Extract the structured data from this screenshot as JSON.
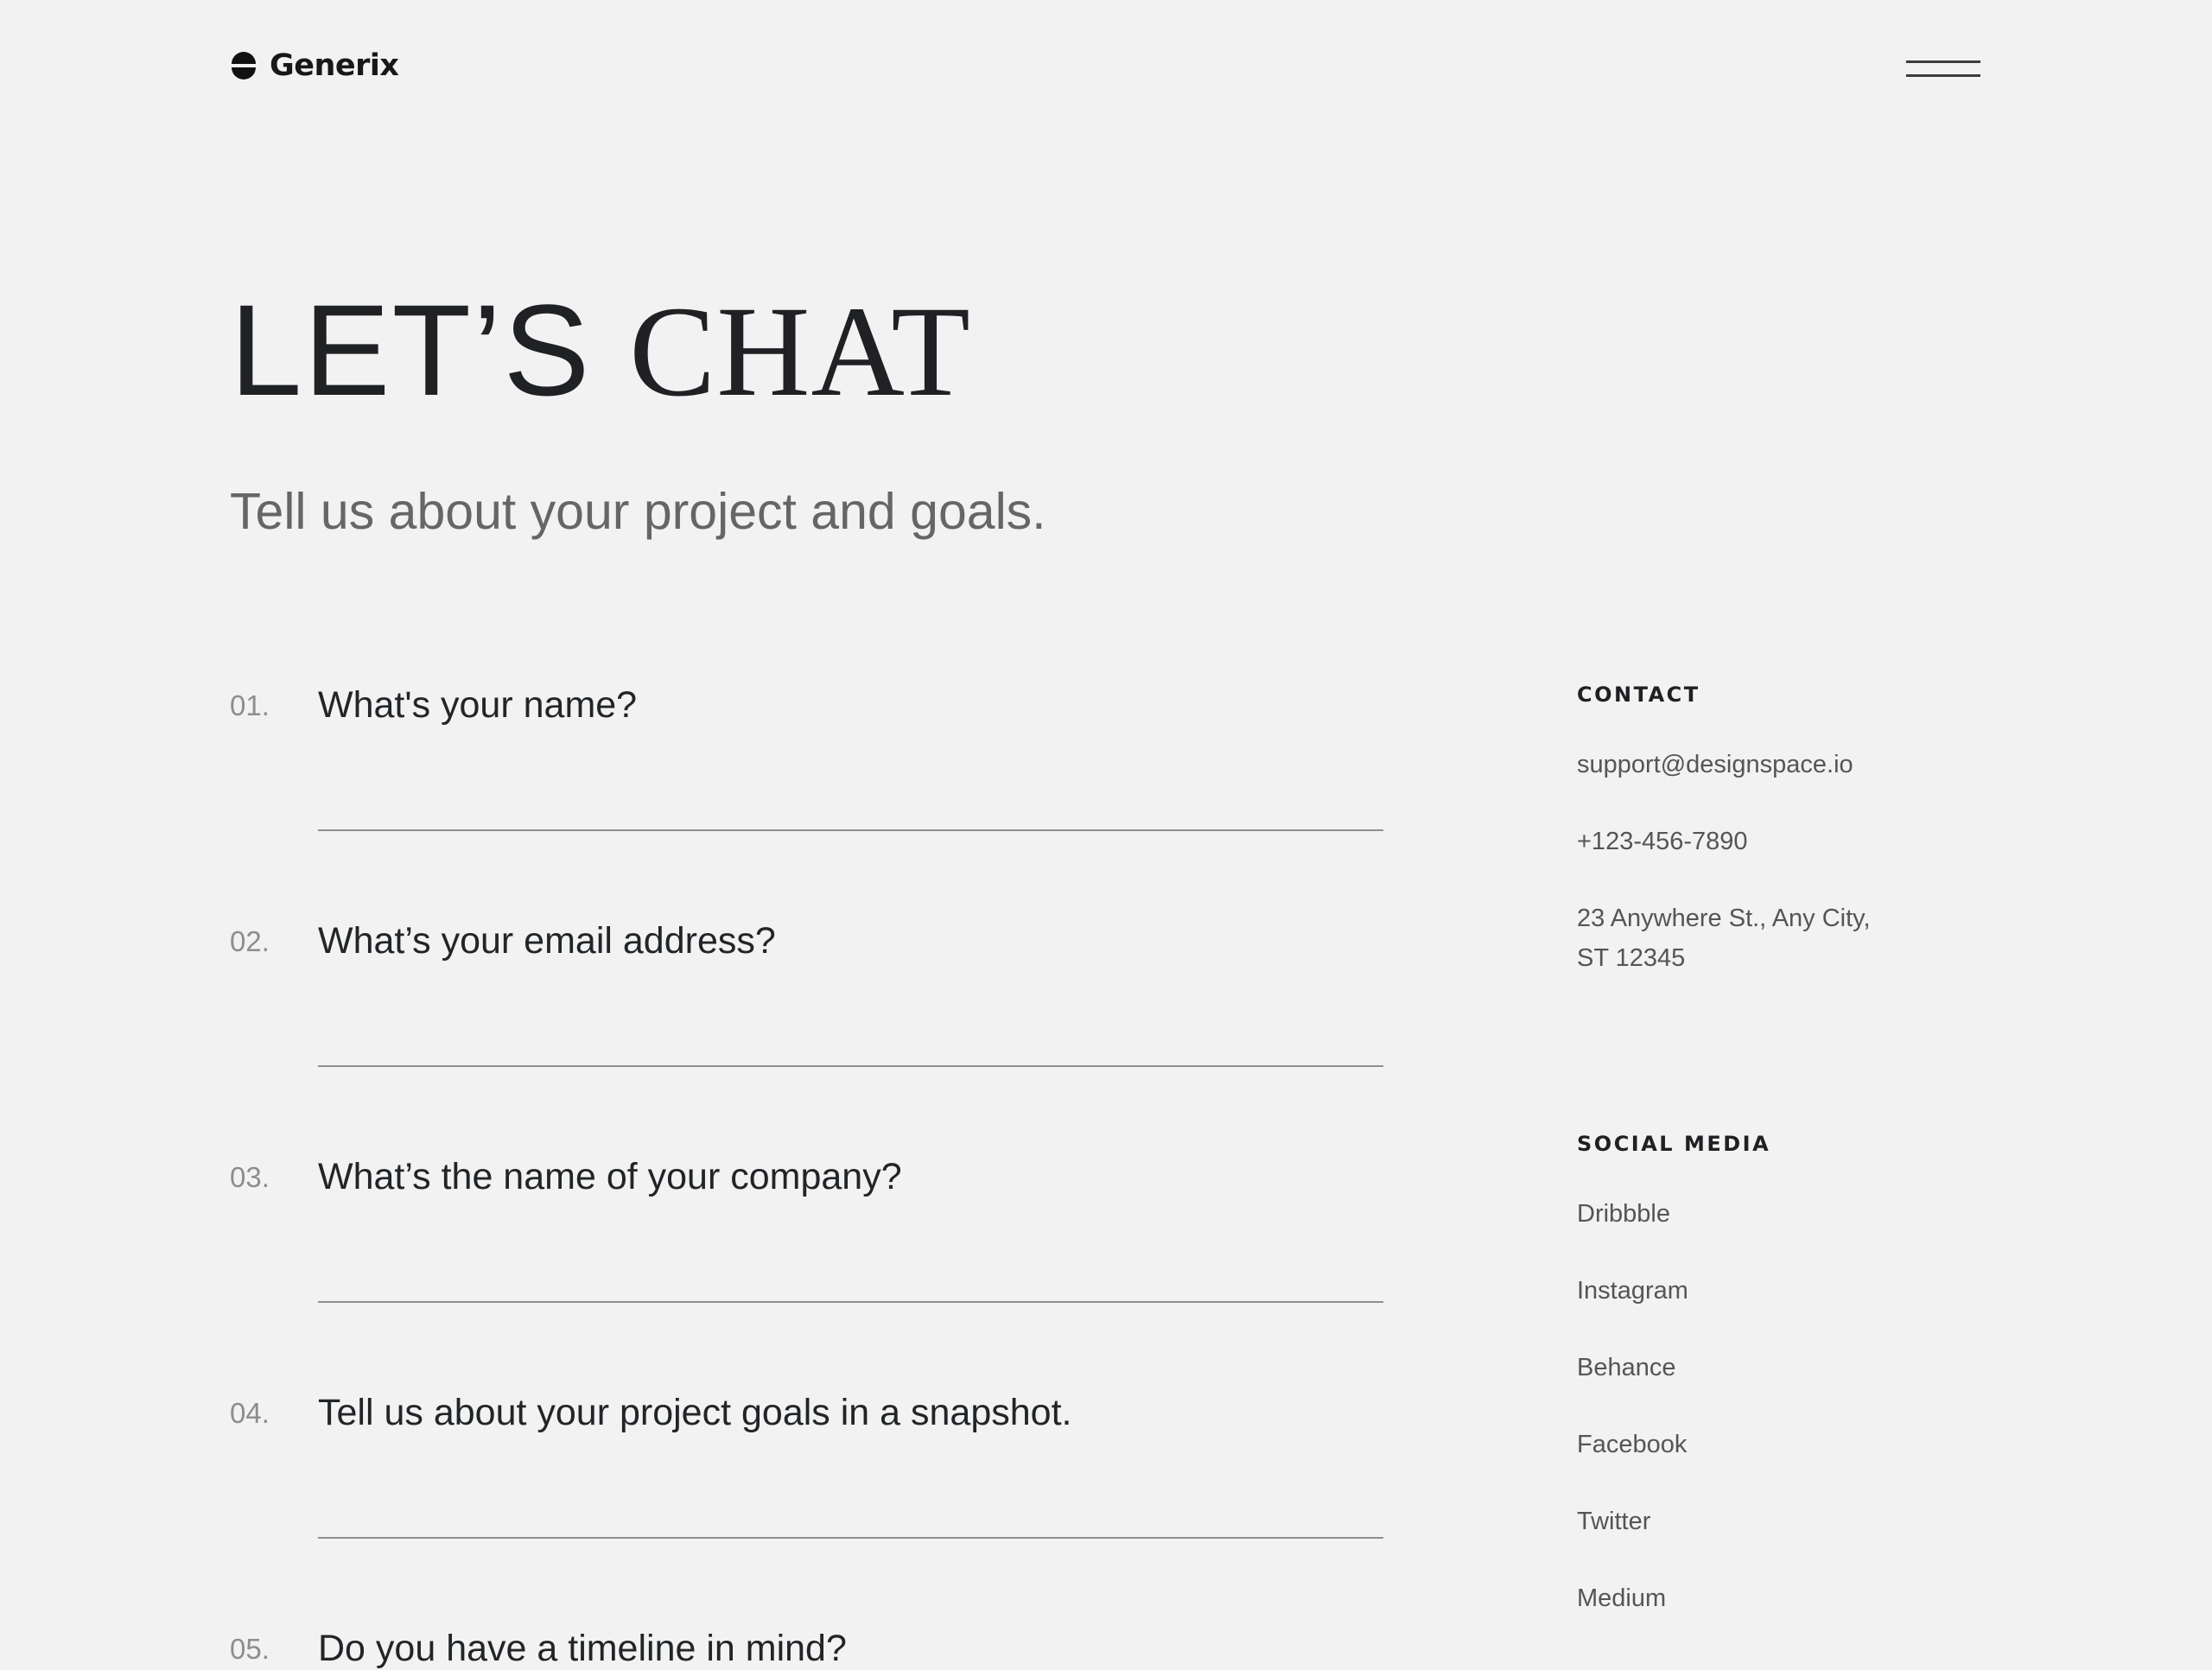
{
  "brand": {
    "name": "Generix"
  },
  "hero": {
    "title_part1": "LET’S",
    "title_part2": "CHAT",
    "subtitle": "Tell us about your project and goals."
  },
  "questions": [
    {
      "number": "01.",
      "label": "What's your name?"
    },
    {
      "number": "02.",
      "label": "What’s your email address?"
    },
    {
      "number": "03.",
      "label": "What’s the name of your company?"
    },
    {
      "number": "04.",
      "label": "Tell us about your project goals in a snapshot."
    },
    {
      "number": "05.",
      "label": "Do you have a timeline in mind?"
    }
  ],
  "contact": {
    "heading": "CONTACT",
    "email": "support@designspace.io",
    "phone": "+123-456-7890",
    "address_line1": "23 Anywhere St., Any City,",
    "address_line2": "ST 12345"
  },
  "social": {
    "heading": "SOCIAL MEDIA",
    "links": [
      "Dribbble",
      "Instagram",
      "Behance",
      "Facebook",
      "Twitter",
      "Medium"
    ]
  },
  "colors": {
    "background": "#f2f2f2",
    "text": "#222528",
    "muted": "#666666",
    "divider": "#8e8e8e"
  }
}
